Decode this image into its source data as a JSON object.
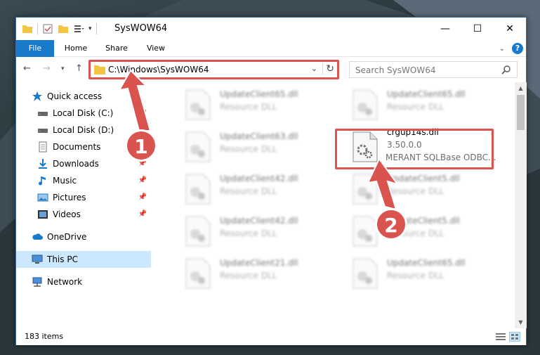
{
  "window": {
    "title": "SysWOW64",
    "minimize": "—",
    "maximize": "☐",
    "close": "✕"
  },
  "ribbon": {
    "tabs": [
      "File",
      "Home",
      "Share",
      "View"
    ]
  },
  "address": {
    "path": "C:\\Windows\\SysWOW64",
    "search_placeholder": "Search SysWOW64"
  },
  "sidebar": {
    "items": [
      {
        "label": "Quick access",
        "icon": "star-icon",
        "pinned": false
      },
      {
        "label": "Local Disk (C:)",
        "icon": "drive-icon",
        "pinned": true
      },
      {
        "label": "Local Disk (D:)",
        "icon": "drive-icon",
        "pinned": true
      },
      {
        "label": "Documents",
        "icon": "documents-icon",
        "pinned": true
      },
      {
        "label": "Downloads",
        "icon": "downloads-icon",
        "pinned": true
      },
      {
        "label": "Music",
        "icon": "music-icon",
        "pinned": true
      },
      {
        "label": "Pictures",
        "icon": "pictures-icon",
        "pinned": true
      },
      {
        "label": "Videos",
        "icon": "videos-icon",
        "pinned": true
      },
      {
        "label": "OneDrive",
        "icon": "cloud-icon",
        "pinned": false
      },
      {
        "label": "This PC",
        "icon": "computer-icon",
        "pinned": false
      },
      {
        "label": "Network",
        "icon": "network-icon",
        "pinned": false
      }
    ]
  },
  "files": [
    {
      "name": "UpdateClient65.dll",
      "sub": "Resource DLL",
      "blurred": true
    },
    {
      "name": "UpdateClient65.dll",
      "sub": "Resource DLL",
      "blurred": true
    },
    {
      "name": "UpdateClient63.dll",
      "sub": "Resource DLL",
      "blurred": true
    },
    {
      "name": "crgup14s.dll",
      "sub": "3.50.0.0",
      "sub2": "MERANT SQLBase ODBC...",
      "blurred": false
    },
    {
      "name": "UpdateClient42.dll",
      "sub": "Resource DLL",
      "blurred": true
    },
    {
      "name": "UpdateClient5.dll",
      "sub": "Resource DLL",
      "blurred": true
    },
    {
      "name": "UpdateClient42.dll",
      "sub": "Resource DLL",
      "blurred": true
    },
    {
      "name": "UpdateClient5.dll",
      "sub": "Resource DLL",
      "blurred": true
    },
    {
      "name": "UpdateClient21.dll",
      "sub": "Resource DLL",
      "blurred": true
    },
    {
      "name": "UpdateClient65.dll",
      "sub": "Resource DLL",
      "blurred": true
    }
  ],
  "status": {
    "item_count": "183 items"
  },
  "annotations": {
    "step1": "1",
    "step2": "2",
    "color": "#d9534f"
  }
}
